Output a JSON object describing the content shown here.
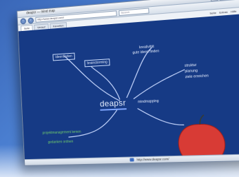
{
  "browser": {
    "window_title": "deapsr — mind map",
    "address": "http://www.deapsr.com/",
    "search_placeholder": "Search",
    "tabs": [
      "Seite",
      "Verlauf",
      "Favoriten"
    ],
    "toolbar_right": [
      "Seite",
      "Extras",
      "Hilfe"
    ]
  },
  "mindmap": {
    "center_label": "deapsr",
    "center_note": "mindmapping",
    "left_top_node": "ideenfinden",
    "left_mid_node": "brainstorming",
    "top_right_node": "kreativität",
    "top_right_sub": "gute ideen finden",
    "right_list": [
      "struktur",
      "planung",
      "ziele erreichen"
    ],
    "green_items": [
      "projektmanagement lernen",
      "gedanken ordnen"
    ]
  },
  "colors": {
    "content_bg": "#163a85",
    "apple": "#d83b35",
    "line": "#c9d9ff",
    "green": "#73d16a"
  },
  "statusbar": {
    "text": "http://www.deapsr.com/"
  }
}
